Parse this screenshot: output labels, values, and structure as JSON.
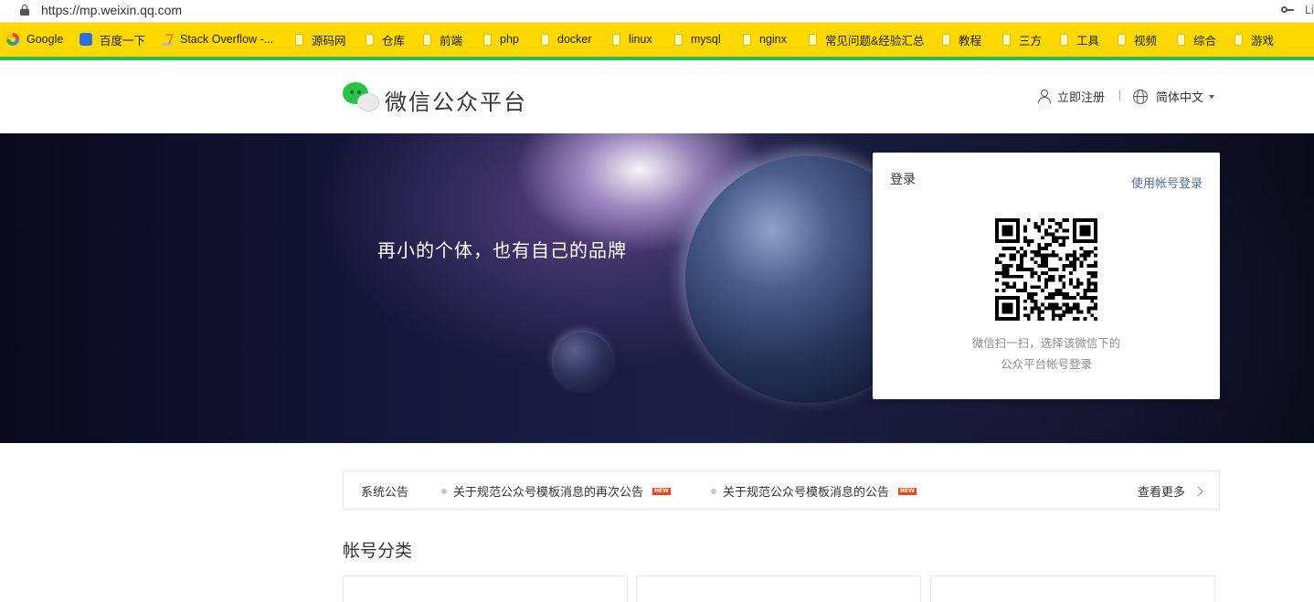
{
  "browser": {
    "url": "https://mp.weixin.qq.com",
    "right_glyph": "Li",
    "bookmarks": [
      {
        "label": "Google",
        "icon": "google-icon"
      },
      {
        "label": "百度一下",
        "icon": "baidu-paw-icon"
      },
      {
        "label": "Stack Overflow -...",
        "icon": "stackoverflow-icon"
      },
      {
        "label": "源码网",
        "icon": "folder-icon"
      },
      {
        "label": "仓库",
        "icon": "folder-icon"
      },
      {
        "label": "前端",
        "icon": "folder-icon"
      },
      {
        "label": "php",
        "icon": "folder-icon"
      },
      {
        "label": "docker",
        "icon": "folder-icon"
      },
      {
        "label": "linux",
        "icon": "folder-icon"
      },
      {
        "label": "mysql",
        "icon": "folder-icon"
      },
      {
        "label": "nginx",
        "icon": "folder-icon"
      },
      {
        "label": "常见问题&经验汇总",
        "icon": "folder-icon"
      },
      {
        "label": "教程",
        "icon": "folder-icon"
      },
      {
        "label": "三方",
        "icon": "folder-icon"
      },
      {
        "label": "工具",
        "icon": "folder-icon"
      },
      {
        "label": "视频",
        "icon": "folder-icon"
      },
      {
        "label": "综合",
        "icon": "folder-icon"
      },
      {
        "label": "游戏",
        "icon": "folder-icon"
      }
    ],
    "colors": {
      "bookmark_bar": "#ffd800",
      "accent_line": "#2db84b"
    }
  },
  "header": {
    "logo_text": "微信公众平台",
    "register_label": "立即注册",
    "language_label": "简体中文"
  },
  "banner": {
    "slogan": "再小的个体，也有自己的品牌",
    "login": {
      "title": "登录",
      "account_login_link": "使用帐号登录",
      "qr_tip_line1": "微信扫一扫，选择该微信下的",
      "qr_tip_line2": "公众平台帐号登录"
    }
  },
  "notices": {
    "label": "系统公告",
    "items": [
      {
        "text": "关于规范公众号模板消息的再次公告",
        "badge": "NEW"
      },
      {
        "text": "关于规范公众号模板消息的公告",
        "badge": "NEW"
      }
    ],
    "more_label": "查看更多"
  },
  "account_types": {
    "title": "帐号分类"
  }
}
